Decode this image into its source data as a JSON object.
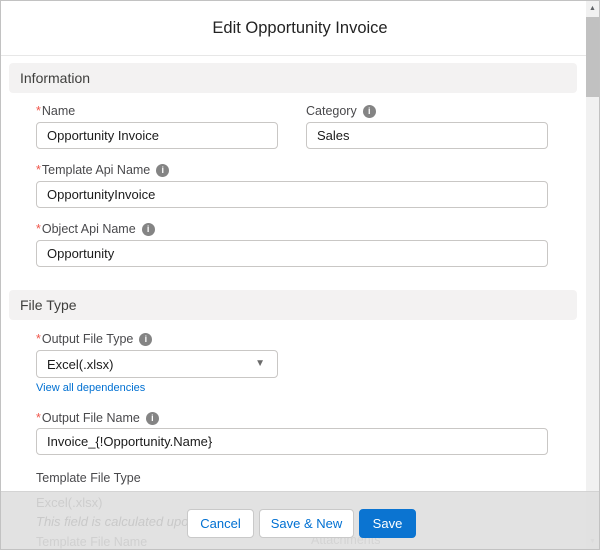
{
  "modal": {
    "title": "Edit Opportunity Invoice"
  },
  "symbols": {
    "required": "*",
    "info": "i",
    "caret_down": "▼",
    "scroll_up": "▲",
    "scroll_down": "▼"
  },
  "sections": {
    "information": {
      "title": "Information"
    },
    "file_type": {
      "title": "File Type"
    }
  },
  "form": {
    "name": {
      "label": "Name",
      "value": "Opportunity Invoice",
      "required": true
    },
    "category": {
      "label": "Category",
      "value": "Sales",
      "has_info": true
    },
    "template_api_name": {
      "label": "Template Api Name",
      "value": "OpportunityInvoice",
      "required": true,
      "has_info": true
    },
    "object_api_name": {
      "label": "Object Api Name",
      "value": "Opportunity",
      "required": true,
      "has_info": true
    },
    "output_file_type": {
      "label": "Output File Type",
      "value": "Excel(.xlsx)",
      "required": true,
      "has_info": true
    },
    "view_dependencies_link": "View all dependencies",
    "output_file_name": {
      "label": "Output File Name",
      "value": "Invoice_{!Opportunity.Name}",
      "required": true,
      "has_info": true
    },
    "template_file_type": {
      "label": "Template File Type"
    }
  },
  "footer": {
    "buttons": {
      "cancel": "Cancel",
      "save_and_new": "Save & New",
      "save": "Save"
    },
    "obscured_content": {
      "template_file_type_value": "Excel(.xlsx)",
      "helper_text": "This field is calculated upon sav",
      "template_file_name_label": "Template File Name",
      "attachments_label": "Attachments"
    }
  },
  "colors": {
    "brand_blue": "#0b74d1",
    "link_blue": "#0070d2",
    "required_red": "#f0554a"
  }
}
